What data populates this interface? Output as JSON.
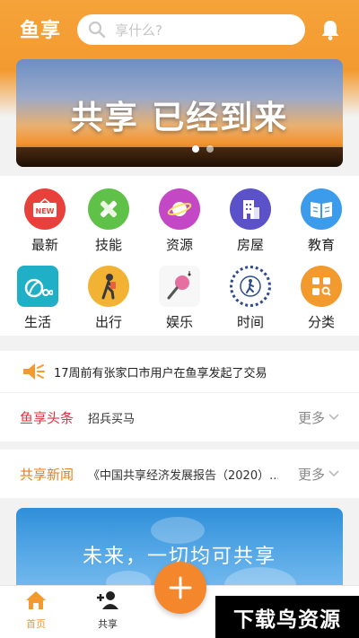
{
  "header": {
    "app_name": "鱼享",
    "search_placeholder": "享什么?"
  },
  "banner": {
    "title": "共享 已经到来",
    "slides": 2
  },
  "categories": [
    {
      "label": "最新",
      "icon": "new-badge-icon",
      "color": "#e8413c"
    },
    {
      "label": "技能",
      "icon": "tools-icon",
      "color": "#5fc148"
    },
    {
      "label": "资源",
      "icon": "planet-icon",
      "color": "#c448c6"
    },
    {
      "label": "房屋",
      "icon": "building-icon",
      "color": "#5b52c9"
    },
    {
      "label": "教育",
      "icon": "book-icon",
      "color": "#3c9bea"
    },
    {
      "label": "生活",
      "icon": "vacuum-icon",
      "color": "#1fb0c8"
    },
    {
      "label": "出行",
      "icon": "walker-icon",
      "color": "#f2b233"
    },
    {
      "label": "娱乐",
      "icon": "microphone-icon",
      "color": "#e46fa0"
    },
    {
      "label": "时间",
      "icon": "clock-icon",
      "color": "#2f4a8f"
    },
    {
      "label": "分类",
      "icon": "grid-icon",
      "color": "#f39a2f"
    }
  ],
  "notice": {
    "text": "17周前有张家口市用户在鱼享发起了交易"
  },
  "headlines": {
    "tag": "鱼享头条",
    "text": "招兵买马",
    "more": "更多",
    "tag_color": "#d9363e"
  },
  "news": {
    "tag": "共享新闻",
    "text": "《中国共享经济发展报告（2020）...",
    "more": "更多",
    "tag_color": "#e0801f"
  },
  "promo": {
    "slogan": "未来，一切均可共享"
  },
  "tabbar": {
    "home": "首页",
    "share": "共享"
  },
  "watermark": {
    "text": "下载鸟资源"
  }
}
